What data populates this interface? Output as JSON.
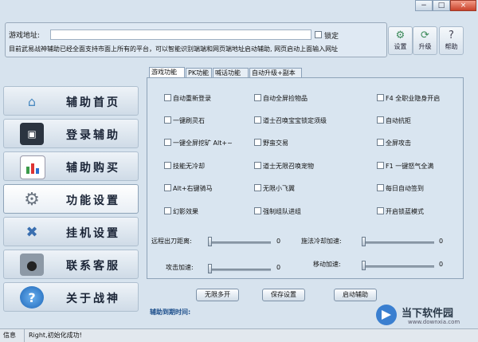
{
  "window": {
    "minimize": "−",
    "restore": "□",
    "close": "×"
  },
  "top": {
    "url_label": "游戏地址:",
    "lock_label": "锁定",
    "notice": "目前武易战神辅助已经全面支持市面上所有的平台，可以智能识别端端和网页端地址启动辅助, 网页启动上面输入网址"
  },
  "toolbar": {
    "settings": {
      "label": "设置",
      "icon": "gear-icon"
    },
    "upgrade": {
      "label": "升级",
      "icon": "refresh-icon"
    },
    "help": {
      "label": "帮助",
      "icon": "question-icon"
    }
  },
  "sidebar": {
    "items": [
      {
        "label": "辅助首页",
        "icon": "home-icon"
      },
      {
        "label": "登录辅助",
        "icon": "monitor-icon"
      },
      {
        "label": "辅助购买",
        "icon": "bar-chart-icon"
      },
      {
        "label": "功能设置",
        "icon": "gear-icon"
      },
      {
        "label": "挂机设置",
        "icon": "tools-icon"
      },
      {
        "label": "联系客服",
        "icon": "user-icon"
      },
      {
        "label": "关于战神",
        "icon": "question-icon"
      }
    ]
  },
  "tabs": [
    "游戏功能",
    "PK功能",
    "喊话功能",
    "自动升级+副本"
  ],
  "options": [
    [
      "自动重新登录",
      "自动全屏捡物品",
      "F4 全职业隐身开启"
    ],
    [
      "一键刷灵石",
      "道士召唤宝宝锁定须级",
      "自动抗拒"
    ],
    [
      "一键全屏挖矿 Alt+~",
      "野蛮交易",
      "全屏攻击"
    ],
    [
      "技能无冷却",
      "道士无限召唤宠物",
      "F1 一键怒气全满"
    ],
    [
      "Alt+右键骑马",
      "无限小飞翼",
      "每日自动签到"
    ],
    [
      "幻影效果",
      "强制组队进组",
      "开启锁蓝模式"
    ]
  ],
  "sliders": [
    {
      "label": "远程出刀距离:",
      "value": "0"
    },
    {
      "label": "施法冷却加速:",
      "value": "0"
    },
    {
      "label": "攻击加速:",
      "value": "0"
    },
    {
      "label": "移动加速:",
      "value": "0"
    }
  ],
  "buttons": {
    "unlimited": "无限多开",
    "save": "保存设置",
    "launch": "启动辅助"
  },
  "expire_label": "辅助到期时间:",
  "status": {
    "info": "信息",
    "message": "Right,初始化成功!"
  },
  "watermark": {
    "title": "当下软件园",
    "url": "www.downxia.com"
  },
  "colors": {
    "accent": "#2c6aa8",
    "panel": "#d9e5f0"
  }
}
